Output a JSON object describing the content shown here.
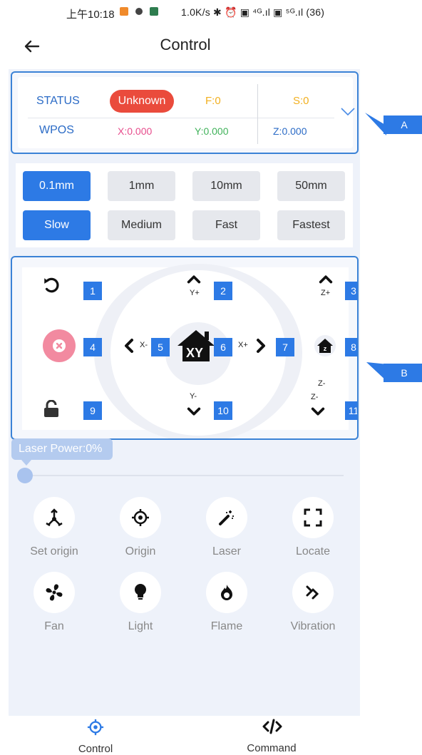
{
  "status_bar": {
    "time": "上午10:18",
    "right": "1.0K/s ✱ ⏰ ▣ ⁴ᴳ.ıl ▣ ⁵ᴳ.ıl (36)"
  },
  "header": {
    "title": "Control"
  },
  "status": {
    "status_label": "STATUS",
    "status_value": "Unknown",
    "f_value": "F:0",
    "s_value": "S:0",
    "wpos_label": "WPOS",
    "x_value": "X:0.000",
    "y_value": "Y:0.000",
    "z_value": "Z:0.000",
    "colors": {
      "label": "#2b6bc6",
      "badge": "#ea4b3c",
      "fs": "#f2b020",
      "x": "#e74c8c",
      "y": "#40b25a",
      "z": "#2b6bc6"
    }
  },
  "step_sizes": [
    "0.1mm",
    "1mm",
    "10mm",
    "50mm"
  ],
  "step_selected": "0.1mm",
  "speeds": [
    "Slow",
    "Medium",
    "Fast",
    "Fastest"
  ],
  "speed_selected": "Slow",
  "jog": {
    "numbers": [
      "1",
      "2",
      "3",
      "4",
      "5",
      "6",
      "7",
      "8",
      "9",
      "10",
      "11"
    ],
    "labels": {
      "y_plus": "Y+",
      "z_plus": "Z+",
      "x_minus": "X-",
      "x_plus": "X+",
      "y_minus": "Y-",
      "z_minus_1": "Z-",
      "z_minus_2": "Z-",
      "home": "XY",
      "home_z": "z"
    },
    "icons": [
      "rotate-ccw-icon",
      "arrow-up-icon",
      "arrow-up-icon",
      "stop-icon",
      "arrow-left-icon",
      "home-xy-icon",
      "arrow-right-icon",
      "home-z-icon",
      "unlock-icon",
      "arrow-down-icon",
      "arrow-down-icon"
    ]
  },
  "laser_power": {
    "label": "Laser Power:0%",
    "value": 0
  },
  "functions": [
    {
      "label": "Set origin",
      "icon": "set-origin-icon"
    },
    {
      "label": "Origin",
      "icon": "crosshair-icon"
    },
    {
      "label": "Laser",
      "icon": "magic-wand-icon"
    },
    {
      "label": "Locate",
      "icon": "frame-corners-icon"
    },
    {
      "label": "Fan",
      "icon": "fan-icon"
    },
    {
      "label": "Light",
      "icon": "bulb-icon"
    },
    {
      "label": "Flame",
      "icon": "flame-icon"
    },
    {
      "label": "Vibration",
      "icon": "vibration-icon"
    }
  ],
  "callouts": {
    "a": "A",
    "b": "B"
  },
  "bottom_nav": [
    {
      "label": "Control",
      "icon": "crosshair-icon",
      "active": true
    },
    {
      "label": "Command",
      "icon": "code-icon",
      "active": false
    }
  ],
  "accent": "#2d7ae5"
}
